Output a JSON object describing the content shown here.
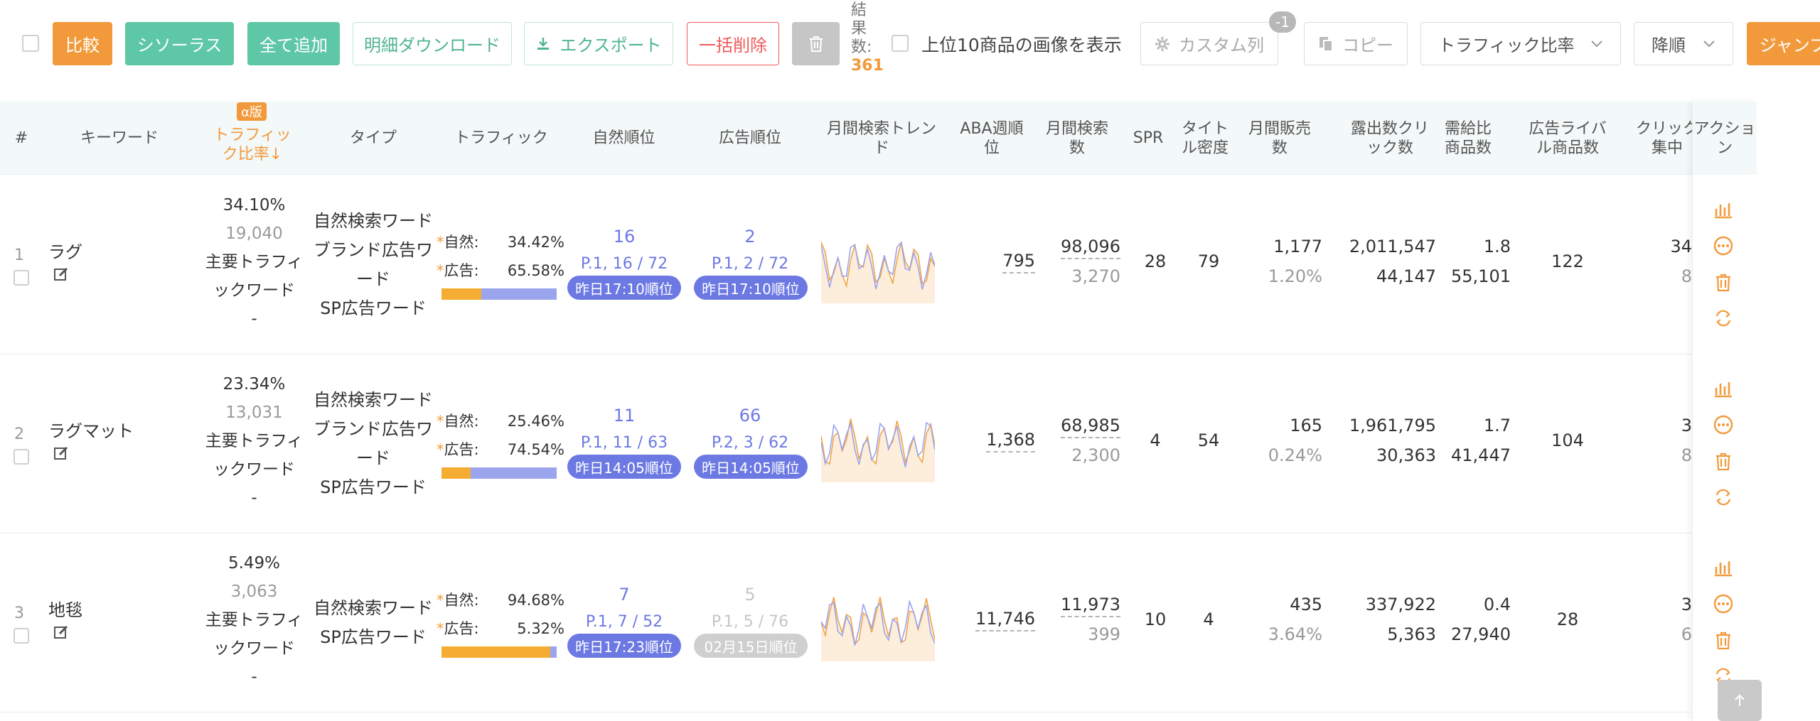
{
  "toolbar": {
    "compare": "比較",
    "thesaurus": "シソーラス",
    "add_all": "全て追加",
    "detail_download": "明細ダウンロード",
    "export": "エクスポート",
    "bulk_delete": "一括削除",
    "result_label": "結果数:",
    "result_count": "361",
    "show_top10": "上位10商品の画像を表示",
    "custom_columns": "カスタム列",
    "custom_badge": "-1",
    "copy": "コピー",
    "sort_field": "トラフィック比率",
    "sort_order": "降順",
    "jump": "ジャンプ"
  },
  "columns": {
    "index": "#",
    "keyword": "キーワード",
    "traffic_ratio": "トラフィック比率↓",
    "alpha_badge": "α版",
    "type": "タイプ",
    "traffic": "トラフィック",
    "organic_rank": "自然順位",
    "ad_rank": "広告順位",
    "monthly_trend": "月間検索トレンド",
    "aba_rank": "ABA週順位",
    "monthly_search": "月間検索数",
    "spr": "SPR",
    "title_density": "タイトル密度",
    "monthly_sales": "月間販売数",
    "impressions_clicks": "露出数クリック数",
    "supply_demand": "需給比商品数",
    "ad_competitors": "広告ライバル商品数",
    "click_concentration": "クリック集中",
    "action": "アクション"
  },
  "labels": {
    "organic": "自然:",
    "ad": "広告:",
    "traffic_main": "主要トラフィックワード",
    "dash": "-"
  },
  "rows": [
    {
      "index": "1",
      "keyword": "ラグ",
      "ratio": "34.10%",
      "ratio_count": "19,040",
      "types": [
        "自然検索ワード",
        "ブランド広告ワード",
        "SP広告ワード"
      ],
      "organic_pct": "34.42%",
      "ad_pct": "65.58%",
      "organic_share": 0.344,
      "organic_rank": "16",
      "organic_page": "P.1, 16 / 72",
      "organic_time": "昨日17:10順位",
      "ad_rank": "2",
      "ad_page": "P.1, 2 / 72",
      "ad_time": "昨日17:10順位",
      "ad_rank_muted": false,
      "aba": "795",
      "monthly_search": "98,096",
      "monthly_search_sub": "3,270",
      "spr": "28",
      "title_density": "79",
      "monthly_sales": "1,177",
      "monthly_sales_rate": "1.20%",
      "impressions": "2,011,547",
      "clicks": "44,147",
      "supply_ratio": "1.8",
      "product_count": "55,101",
      "ad_competitors": "122",
      "click_conc": "34",
      "click_conc_sub": "8"
    },
    {
      "index": "2",
      "keyword": "ラグマット",
      "ratio": "23.34%",
      "ratio_count": "13,031",
      "types": [
        "自然検索ワード",
        "ブランド広告ワード",
        "SP広告ワード"
      ],
      "organic_pct": "25.46%",
      "ad_pct": "74.54%",
      "organic_share": 0.255,
      "organic_rank": "11",
      "organic_page": "P.1, 11 / 63",
      "organic_time": "昨日14:05順位",
      "ad_rank": "66",
      "ad_page": "P.2, 3 / 62",
      "ad_time": "昨日14:05順位",
      "ad_rank_muted": false,
      "aba": "1,368",
      "monthly_search": "68,985",
      "monthly_search_sub": "2,300",
      "spr": "4",
      "title_density": "54",
      "monthly_sales": "165",
      "monthly_sales_rate": "0.24%",
      "impressions": "1,961,795",
      "clicks": "30,363",
      "supply_ratio": "1.7",
      "product_count": "41,447",
      "ad_competitors": "104",
      "click_conc": "3",
      "click_conc_sub": "8"
    },
    {
      "index": "3",
      "keyword": "地毯",
      "ratio": "5.49%",
      "ratio_count": "3,063",
      "types": [
        "自然検索ワード",
        "SP広告ワード"
      ],
      "organic_pct": "94.68%",
      "ad_pct": "5.32%",
      "organic_share": 0.947,
      "organic_rank": "7",
      "organic_page": "P.1, 7 / 52",
      "organic_time": "昨日17:23順位",
      "ad_rank": "5",
      "ad_page": "P.1, 5 / 76",
      "ad_time": "02月15日順位",
      "ad_rank_muted": true,
      "aba": "11,746",
      "monthly_search": "11,973",
      "monthly_search_sub": "399",
      "spr": "10",
      "title_density": "4",
      "monthly_sales": "435",
      "monthly_sales_rate": "3.64%",
      "impressions": "337,922",
      "clicks": "5,363",
      "supply_ratio": "0.4",
      "product_count": "27,940",
      "ad_competitors": "28",
      "click_conc": "3",
      "click_conc_sub": "6"
    }
  ],
  "icons": {
    "edit": "edit-icon",
    "chart": "bar-chart-icon",
    "more": "more-icon",
    "delete": "trash-icon",
    "refresh": "refresh-icon",
    "download": "download-icon",
    "gear": "gear-icon",
    "copy": "copy-icon",
    "chevron": "chevron-down-icon",
    "scroll_top": "arrow-up-icon"
  },
  "colors": {
    "accent_orange": "#f29a3b",
    "accent_green": "#5ec7a6",
    "rank_blue": "#6c79e3",
    "danger_red": "#f05a5a",
    "trend_orange": "#f0a54a",
    "trend_purple": "#9ba5ee"
  }
}
